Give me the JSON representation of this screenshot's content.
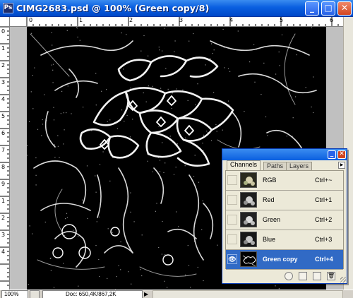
{
  "window": {
    "title": "CIMG2683.psd @ 100% (Green copy/8)",
    "doc_icon": "Ps",
    "minimize_icon": "minimize-icon",
    "maximize_icon": "maximize-icon",
    "close_icon": "close-icon"
  },
  "rulers": {
    "top": [
      "0",
      "1",
      "2",
      "3",
      "4",
      "5",
      "6"
    ],
    "left": [
      "0",
      "1",
      "2",
      "3",
      "4",
      "5",
      "6",
      "7",
      "8",
      "9",
      "1",
      "2",
      "3",
      "4"
    ]
  },
  "status": {
    "zoom": "100%",
    "doc_info": "Doc: 650,4K/867,2K",
    "arrow": "▶"
  },
  "channels_palette": {
    "tabs": [
      "Channels",
      "Paths",
      "Layers"
    ],
    "active_tab": "Channels",
    "channels": [
      {
        "name": "RGB",
        "shortcut": "Ctrl+~",
        "visible": false,
        "selected": false
      },
      {
        "name": "Red",
        "shortcut": "Ctrl+1",
        "visible": false,
        "selected": false
      },
      {
        "name": "Green",
        "shortcut": "Ctrl+2",
        "visible": false,
        "selected": false
      },
      {
        "name": "Blue",
        "shortcut": "Ctrl+3",
        "visible": false,
        "selected": false
      },
      {
        "name": "Green copy",
        "shortcut": "Ctrl+4",
        "visible": true,
        "selected": true
      }
    ],
    "footer_icons": [
      "load-selection-icon",
      "save-selection-icon",
      "new-channel-icon",
      "delete-channel-icon"
    ]
  },
  "colors": {
    "titlebar": "#0a5fe0",
    "selection": "#316ac5",
    "canvas": "#000000",
    "palette_bg": "#ece9d8"
  }
}
